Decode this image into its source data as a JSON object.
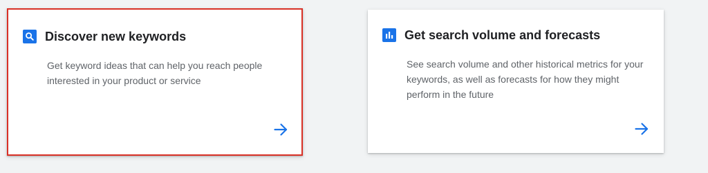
{
  "cards": [
    {
      "title": "Discover new keywords",
      "description": "Get keyword ideas that can help you reach people interested in your product or service",
      "icon": "search-icon",
      "selected": true
    },
    {
      "title": "Get search volume and forecasts",
      "description": "See search volume and other historical metrics for your keywords, as well as forecasts for how they might perform in the future",
      "icon": "bar-chart-icon",
      "selected": false
    }
  ],
  "colors": {
    "page_background": "#f1f3f4",
    "card_background": "#ffffff",
    "accent": "#1a73e8",
    "selected_border": "#d93025",
    "title_text": "#202124",
    "description_text": "#5f6368"
  }
}
